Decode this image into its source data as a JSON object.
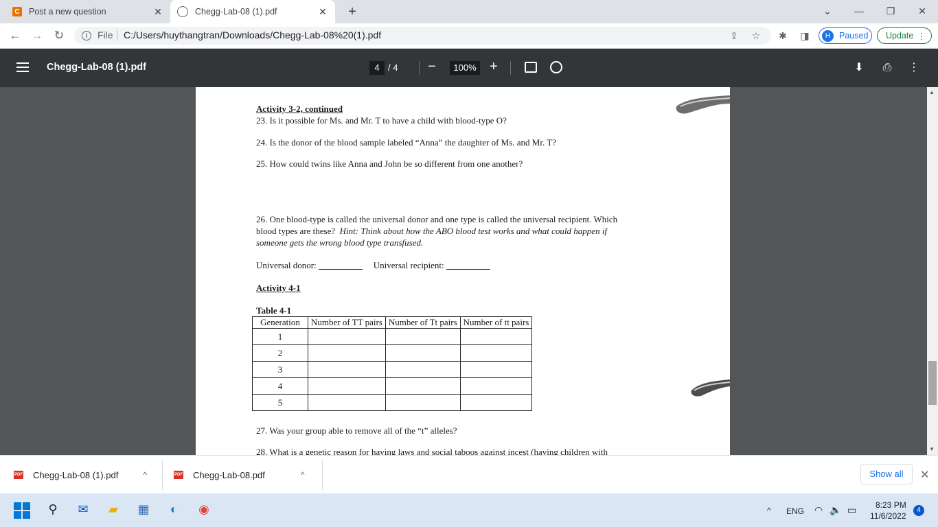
{
  "tabs": [
    {
      "title": "Post a new question",
      "icon": "chegg-favicon"
    },
    {
      "title": "Chegg-Lab-08 (1).pdf",
      "icon": "globe-icon"
    }
  ],
  "address": {
    "scheme_label": "File",
    "url": "C:/Users/huythangtran/Downloads/Chegg-Lab-08%20(1).pdf"
  },
  "profile": {
    "initial": "H",
    "status": "Paused"
  },
  "update_label": "Update",
  "pdf_toolbar": {
    "title": "Chegg-Lab-08 (1).pdf",
    "current_page": "4",
    "total_pages": "/ 4",
    "zoom": "100%"
  },
  "document": {
    "heading_continued": "Activity 3-2, continued",
    "q23": "23. Is it possible for Ms. and Mr. T to have a child with blood-type O?",
    "q24": "24. Is the donor of the blood sample labeled “Anna” the daughter of Ms. and Mr. T?",
    "q25": "25. How could twins like Anna and John be so different from one another?",
    "q26_line1": "26.  One blood-type is called the universal donor and one type is called the universal recipient. Which",
    "q26_line2_plain": "blood types are these?",
    "q26_line2_hint": "Hint: Think about how the ABO blood test works and what could happen if",
    "q26_line3": "someone gets the wrong blood type transfused.",
    "donor_label": "Universal donor:",
    "recipient_label": "Universal recipient:",
    "activity41": "Activity 4-1",
    "table_title": "Table 4-1",
    "table_headers": [
      "Generation",
      "Number of TT pairs",
      "Number of Tt pairs",
      "Number of tt pairs"
    ],
    "table_rows": [
      "1",
      "2",
      "3",
      "4",
      "5"
    ],
    "q27": "27. Was your group able to remove all of the “t” alleles?",
    "q28_partial": "28. What is a genetic reason for having laws and social taboos against incest (having children with"
  },
  "downloads": [
    {
      "name": "Chegg-Lab-08 (1).pdf",
      "badge": "PDF"
    },
    {
      "name": "Chegg-Lab-08.pdf",
      "badge": "PDF"
    }
  ],
  "downloads_show_all": "Show all",
  "taskbar": {
    "language": "ENG",
    "time": "8:23 PM",
    "date": "11/6/2022",
    "notifications": "4"
  },
  "colors": {
    "pdf_toolbar_bg": "#323639",
    "viewer_bg": "#525659",
    "accent_blue": "#1a73e8",
    "update_green": "#188038",
    "chegg_orange": "#eb7100"
  }
}
